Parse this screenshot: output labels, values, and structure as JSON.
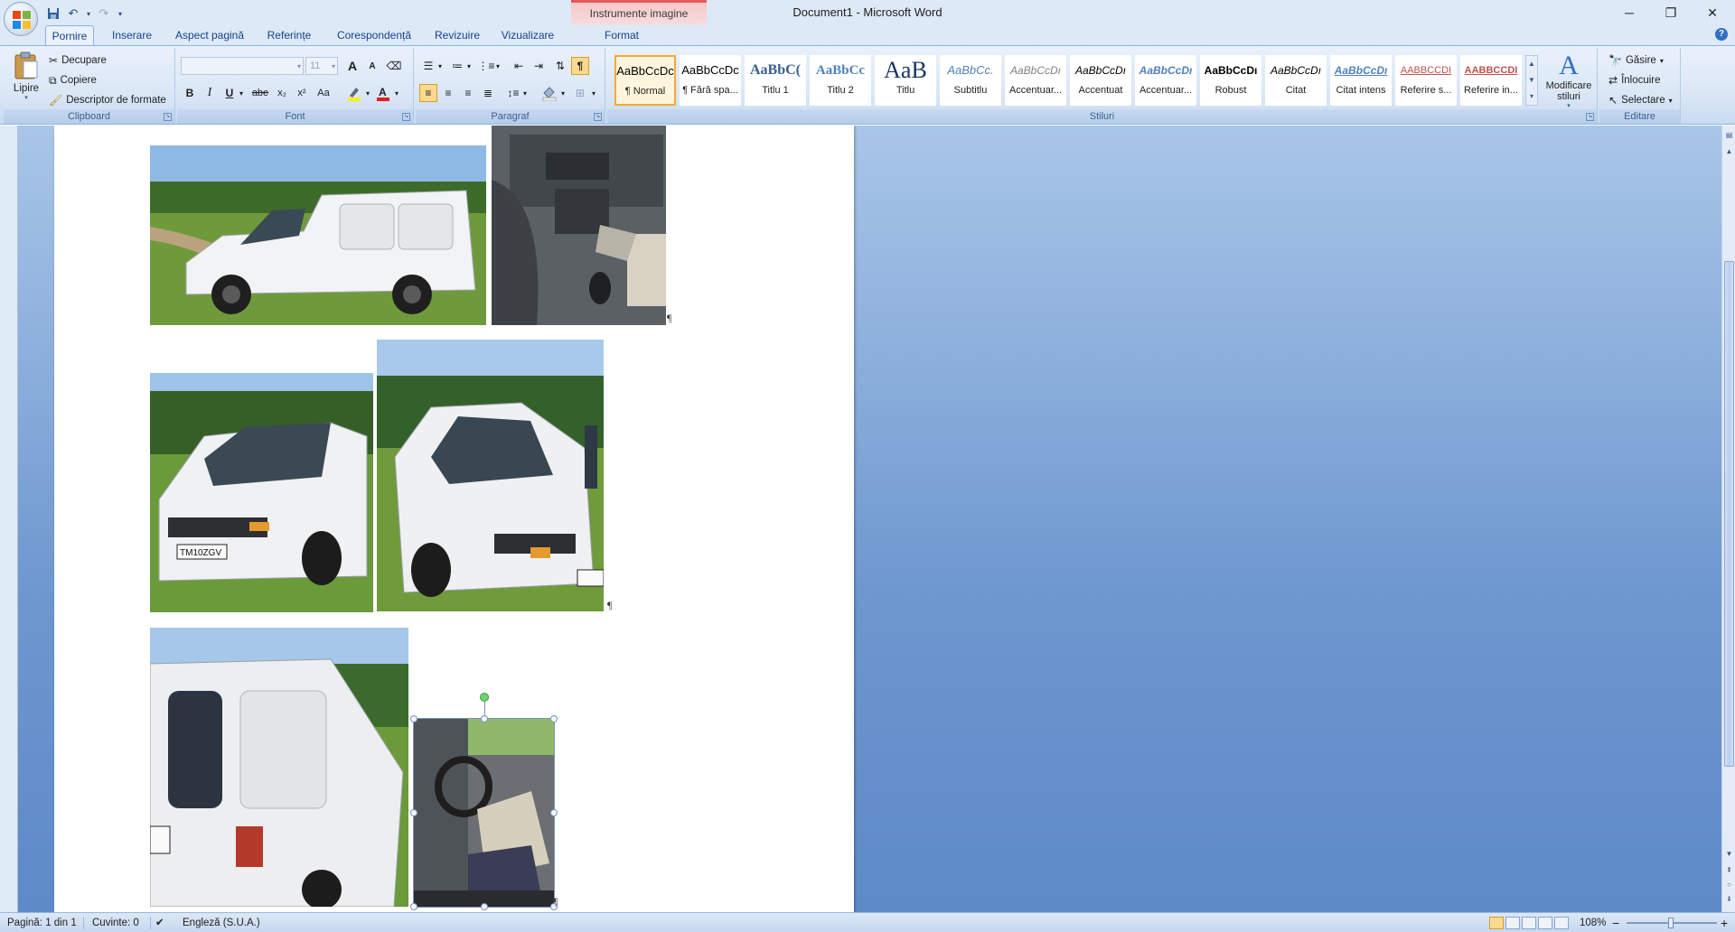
{
  "window": {
    "title": "Document1 - Microsoft Word",
    "context_tab_group": "Instrumente imagine",
    "controls": {
      "minimize": "─",
      "maximize": "❐",
      "close": "✕"
    }
  },
  "qat": {
    "save": "💾",
    "undo": "↶",
    "redo": "↷",
    "more": "▾"
  },
  "tabs": [
    {
      "label": "Pornire",
      "active": true
    },
    {
      "label": "Inserare"
    },
    {
      "label": "Aspect pagină"
    },
    {
      "label": "Referințe"
    },
    {
      "label": "Corespondență"
    },
    {
      "label": "Revizuire"
    },
    {
      "label": "Vizualizare"
    },
    {
      "label": "Format"
    }
  ],
  "ribbon": {
    "clipboard": {
      "label": "Clipboard",
      "paste": "Lipire",
      "cut": "Decupare",
      "copy": "Copiere",
      "format_painter": "Descriptor de formate"
    },
    "font": {
      "label": "Font",
      "font_name": "",
      "font_size": "11",
      "bold": "B",
      "italic": "I",
      "underline": "U",
      "strike": "abe",
      "subscript": "x₂",
      "superscript": "x²",
      "change_case": "Aa",
      "grow": "A",
      "shrink": "A"
    },
    "paragraph": {
      "label": "Paragraf",
      "pilcrow": "¶"
    },
    "styles": {
      "label": "Stiluri",
      "change_styles": "Modificare stiluri",
      "items": [
        {
          "preview": "AaBbCcDc",
          "name": "¶ Normal",
          "selected": true
        },
        {
          "preview": "AaBbCcDc",
          "name": "¶ Fără spa..."
        },
        {
          "preview": "AaBbC(",
          "name": "Titlu 1"
        },
        {
          "preview": "AaBbCc",
          "name": "Titlu 2"
        },
        {
          "preview": "AaB",
          "name": "Titlu"
        },
        {
          "preview": "AaBbCc.",
          "name": "Subtitlu"
        },
        {
          "preview": "AaBbCcDı",
          "name": "Accentuar..."
        },
        {
          "preview": "AaBbCcDı",
          "name": "Accentuat"
        },
        {
          "preview": "AaBbCcDı",
          "name": "Accentuar..."
        },
        {
          "preview": "AaBbCcDı",
          "name": "Robust"
        },
        {
          "preview": "AaBbCcDı",
          "name": "Citat"
        },
        {
          "preview": "AaBbCcDı",
          "name": "Citat intens"
        },
        {
          "preview": "AABBCCDI",
          "name": "Referire s..."
        },
        {
          "preview": "AABBCCDI",
          "name": "Referire in..."
        }
      ]
    },
    "editing": {
      "label": "Editare",
      "find": "Găsire",
      "replace": "Înlocuire",
      "select": "Selectare"
    }
  },
  "document": {
    "pilcrow": "¶"
  },
  "status": {
    "page": "Pagină: 1 din 1",
    "words": "Cuvinte: 0",
    "language": "Engleză (S.U.A.)",
    "zoom": "108%",
    "zoom_minus": "−",
    "zoom_plus": "+"
  },
  "colors": {
    "accent": "#15428b",
    "ribbon_bg": "#dbe7f6",
    "workspace": "#6e97cf",
    "context_tab": "#f7c7c7",
    "selected_style": "#f6a938"
  }
}
